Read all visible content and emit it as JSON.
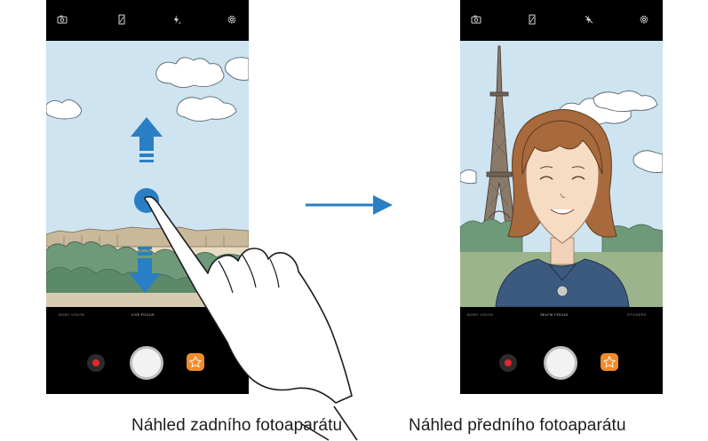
{
  "left_phone": {
    "modes": {
      "mode1": "BIXBY VISION",
      "mode2": "LIVE FOCUS"
    },
    "caption": "Náhled zadního fotoaparátu"
  },
  "right_phone": {
    "modes": {
      "mode1": "BIXBY VISION",
      "mode2": "SELFIE FOCUS",
      "mode3": "STICKERS"
    },
    "caption": "Náhled předního fotoaparátu"
  },
  "colors": {
    "accent_blue": "#2a7fc4",
    "sky": "#cfe4f1",
    "record_red": "#e0282e",
    "sticker_orange": "#f08c2a"
  }
}
